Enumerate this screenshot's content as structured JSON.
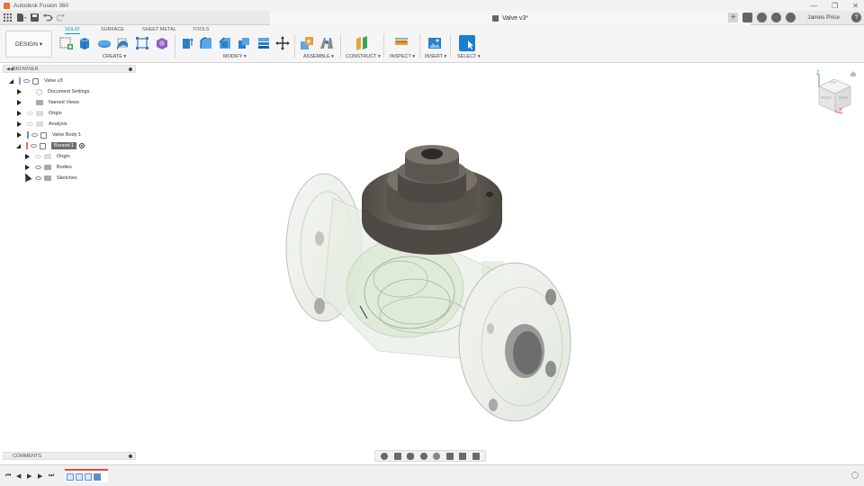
{
  "window": {
    "app_title": "Autodesk Fusion 360",
    "minimize": "—",
    "restore": "❐",
    "close": "✕"
  },
  "tabbar": {
    "document_title": "Valve v3*",
    "user_name": "James Price",
    "help": "?"
  },
  "toolbar": {
    "workspace": "DESIGN ▾",
    "tabs": [
      "SOLID",
      "SURFACE",
      "SHEET METAL",
      "TOOLS"
    ],
    "groups": [
      "CREATE ▾",
      "MODIFY ▾",
      "ASSEMBLE ▾",
      "CONSTRUCT ▾",
      "INSPECT ▾",
      "INSERT ▾",
      "SELECT ▾"
    ]
  },
  "browser": {
    "title": "BROWSER",
    "items": [
      {
        "label": "Valve v3"
      },
      {
        "label": "Document Settings"
      },
      {
        "label": "Named Views"
      },
      {
        "label": "Origin"
      },
      {
        "label": "Analysis"
      },
      {
        "label": "Valve Body:1"
      },
      {
        "label": "Bonnet:1"
      },
      {
        "label": "Origin"
      },
      {
        "label": "Bodies"
      },
      {
        "label": "Sketches"
      }
    ]
  },
  "viewcube": {
    "axis_z": "Z",
    "axis_x": "X",
    "face_front": "FRONT",
    "face_right": "RIGHT",
    "face_top": "TOP"
  },
  "comments": {
    "title": "COMMENTS"
  },
  "timeline": {
    "first": "⏮",
    "prev": "◀",
    "play": "▶",
    "next": "▶",
    "last": "⏭"
  },
  "colors": {
    "accent": "#0696d7",
    "timeline_marker": "#e24b3a",
    "bonnet_metal": "#6b655f",
    "body_translucent": "#cfe0c8"
  }
}
